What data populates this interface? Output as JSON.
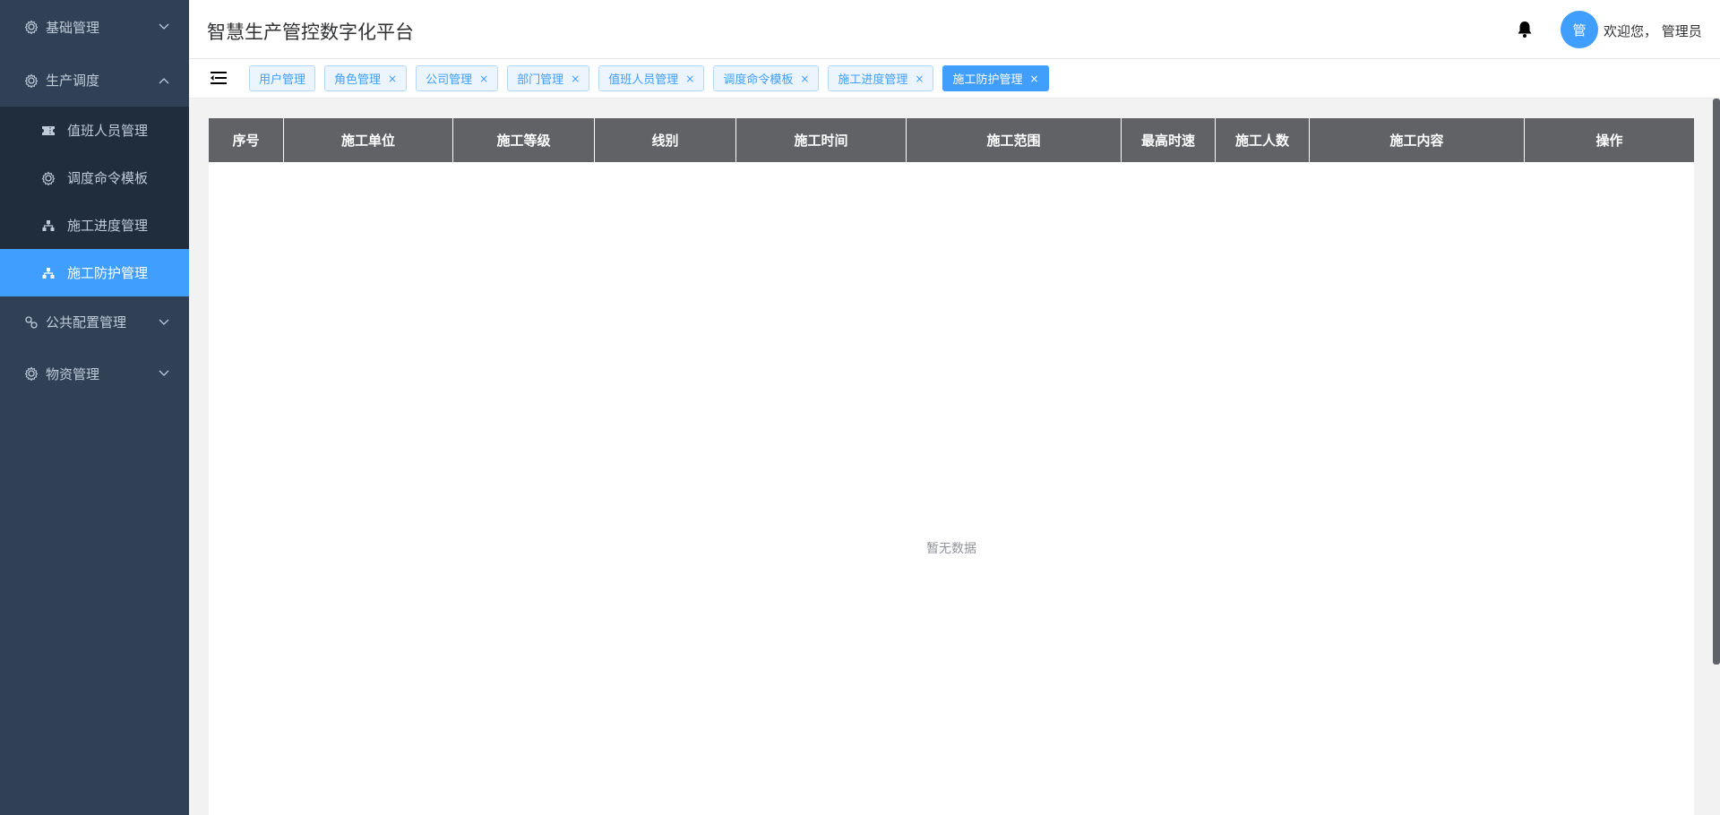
{
  "sidebar": {
    "items": [
      {
        "label": "基础管理",
        "icon": "settings-icon",
        "expanded": false
      },
      {
        "label": "生产调度",
        "icon": "settings-icon",
        "expanded": true
      },
      {
        "label": "公共配置管理",
        "icon": "link-icon",
        "expanded": false
      },
      {
        "label": "物资管理",
        "icon": "settings-icon",
        "expanded": false
      }
    ],
    "submenu": [
      {
        "label": "值班人员管理",
        "icon": "ticket-icon"
      },
      {
        "label": "调度命令模板",
        "icon": "settings-icon"
      },
      {
        "label": "施工进度管理",
        "icon": "org-chart-icon"
      },
      {
        "label": "施工防护管理",
        "icon": "org-chart-icon",
        "active": true
      }
    ]
  },
  "header": {
    "title": "智慧生产管控数字化平台",
    "avatar_text": "管",
    "welcome": "欢迎您， 管理员"
  },
  "tags": [
    {
      "label": "用户管理",
      "closable": false
    },
    {
      "label": "角色管理",
      "closable": true
    },
    {
      "label": "公司管理",
      "closable": true
    },
    {
      "label": "部门管理",
      "closable": true
    },
    {
      "label": "值班人员管理",
      "closable": true
    },
    {
      "label": "调度命令模板",
      "closable": true
    },
    {
      "label": "施工进度管理",
      "closable": true
    },
    {
      "label": "施工防护管理",
      "closable": true,
      "active": true
    }
  ],
  "table": {
    "columns": [
      "序号",
      "施工单位",
      "施工等级",
      "线别",
      "施工时间",
      "施工范围",
      "最高时速",
      "施工人数",
      "施工内容",
      "操作"
    ],
    "rows": [],
    "empty_text": "暂无数据"
  },
  "colors": {
    "sidebar_bg": "#304156",
    "submenu_bg": "#1f2d3d",
    "accent": "#409eff",
    "table_header_bg": "#606266"
  }
}
